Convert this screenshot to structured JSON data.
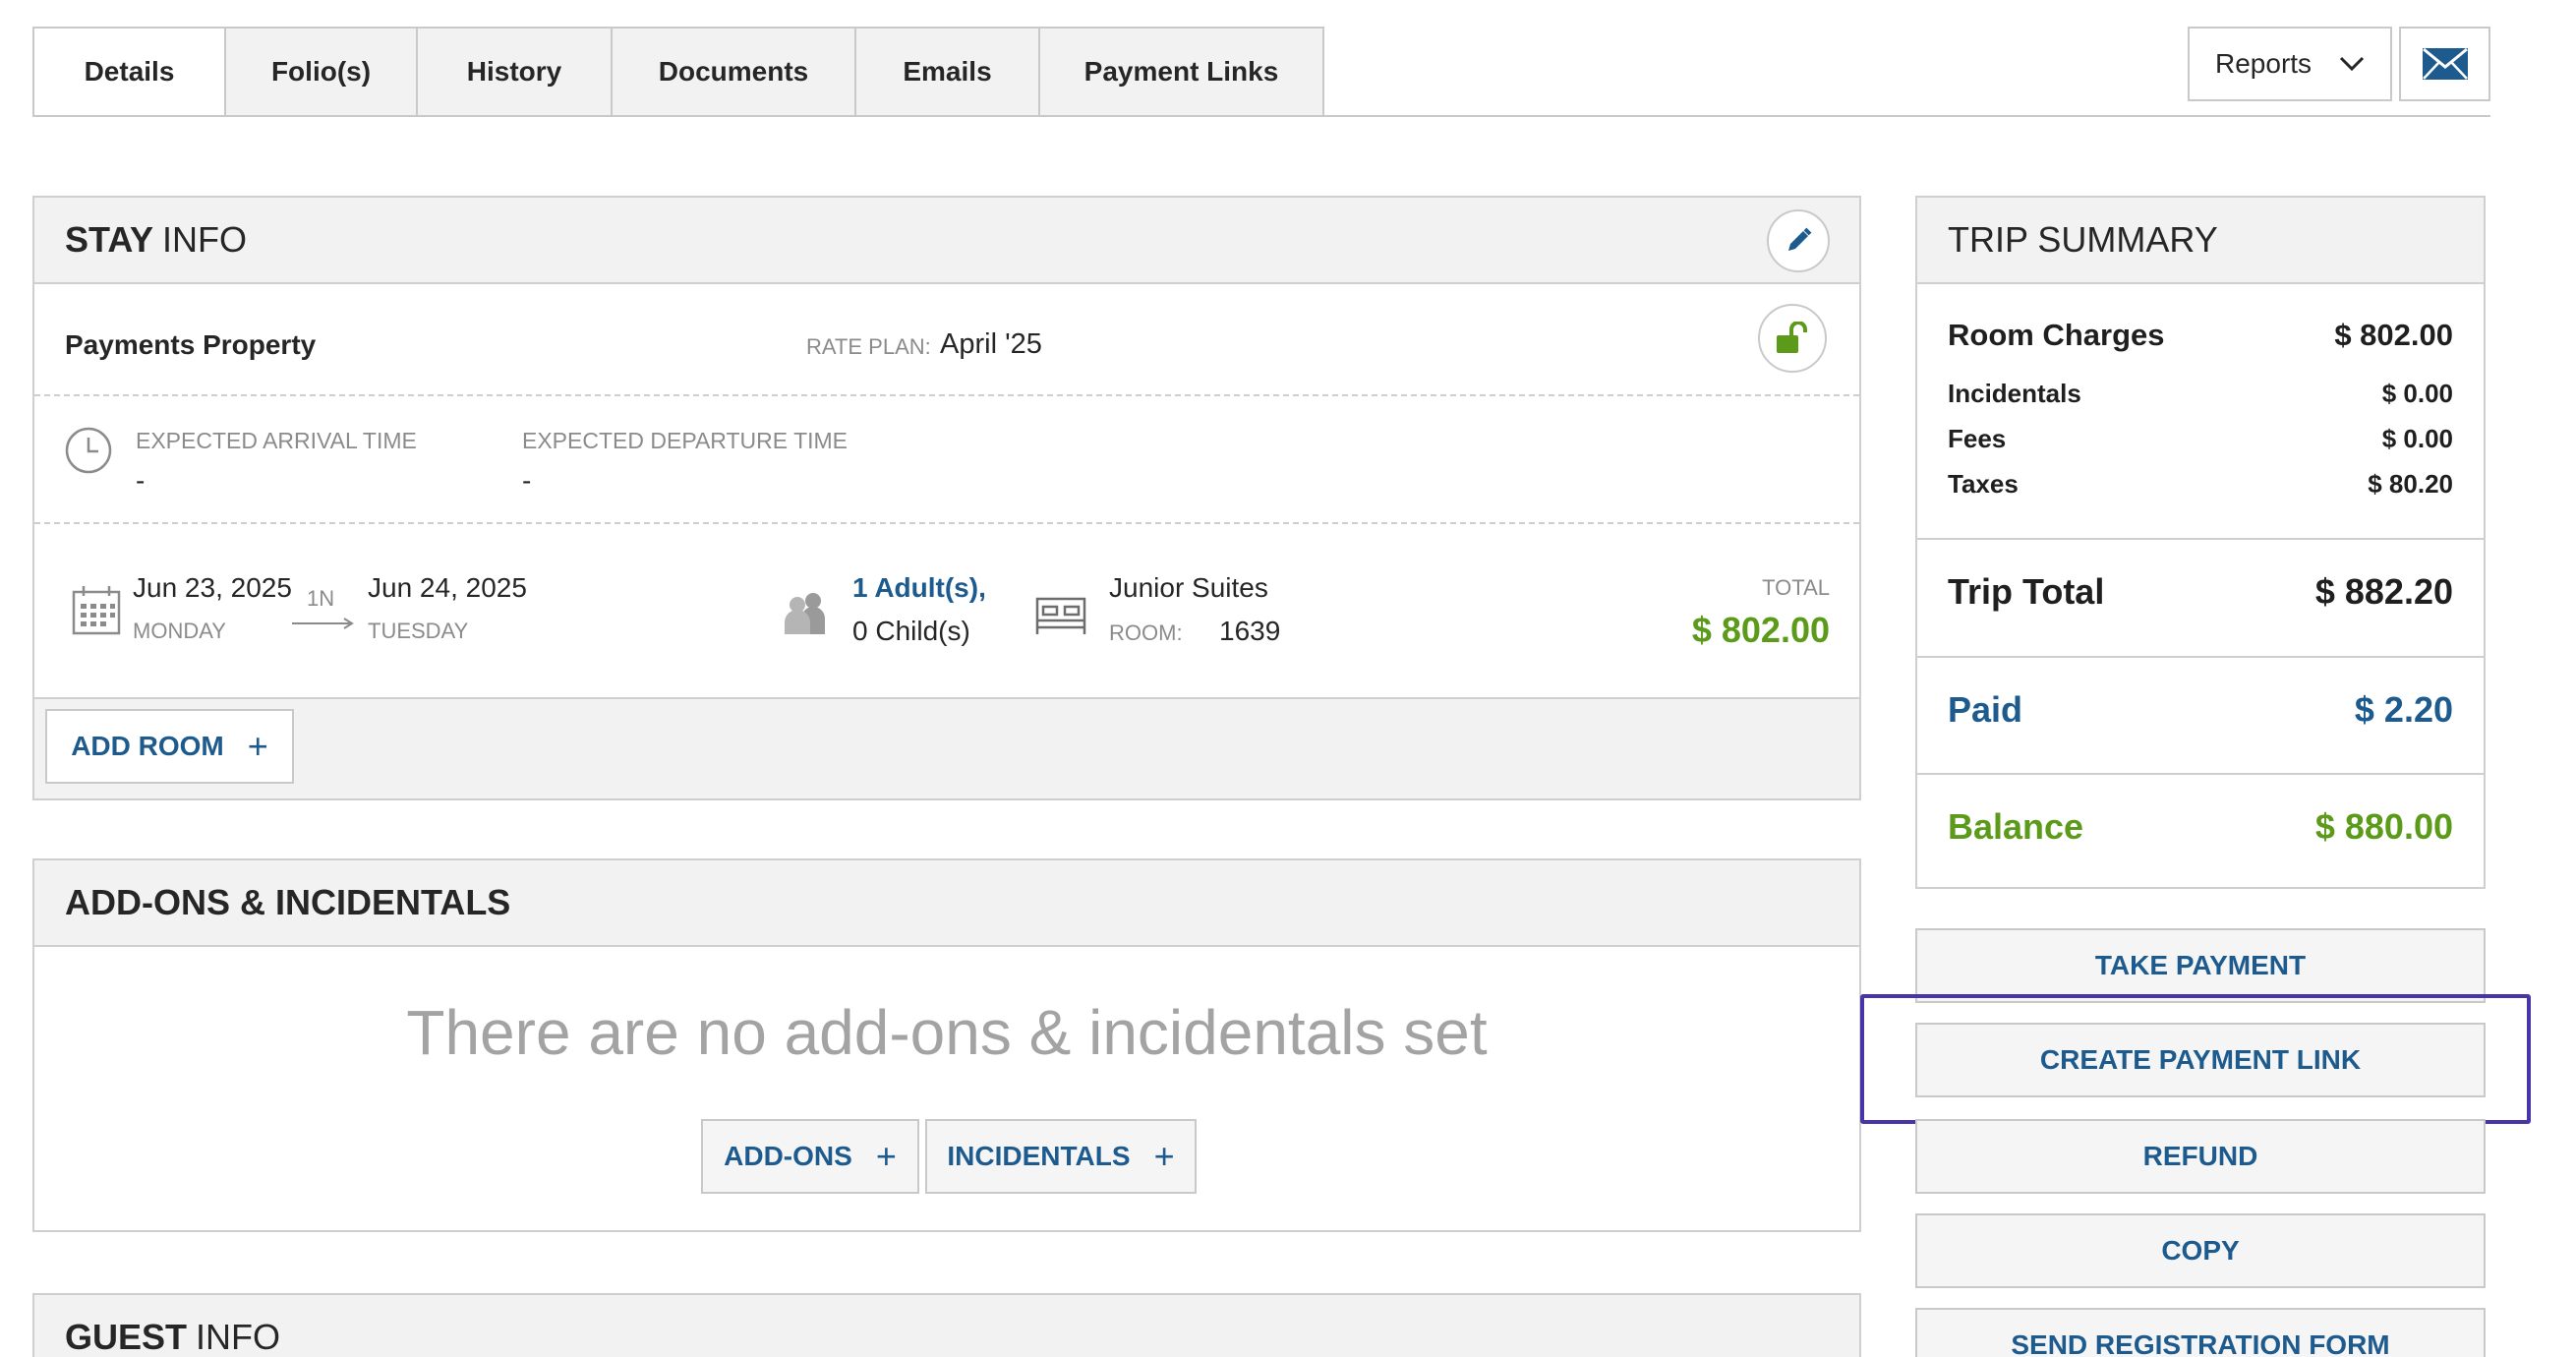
{
  "tabs": [
    {
      "label": "Details",
      "active": true
    },
    {
      "label": "Folio(s)"
    },
    {
      "label": "History"
    },
    {
      "label": "Documents"
    },
    {
      "label": "Emails"
    },
    {
      "label": "Payment Links"
    }
  ],
  "reports_label": "Reports",
  "stay_info": {
    "title_bold": "STAY",
    "title_rest": "INFO",
    "property": "Payments Property",
    "rate_plan_label": "RATE PLAN:",
    "rate_plan": "April '25",
    "arrival_label": "EXPECTED ARRIVAL TIME",
    "arrival_value": "-",
    "departure_label": "EXPECTED DEPARTURE TIME",
    "departure_value": "-",
    "checkin_date": "Jun 23, 2025",
    "checkin_day": "MONDAY",
    "nights": "1N",
    "checkout_date": "Jun 24, 2025",
    "checkout_day": "TUESDAY",
    "adults": "1 Adult(s),",
    "children": "0 Child(s)",
    "room_type": "Junior Suites",
    "room_label": "ROOM:",
    "room_number": "1639",
    "total_label": "TOTAL",
    "total_value": "$ 802.00",
    "add_room": "ADD ROOM"
  },
  "addons": {
    "title": "ADD-ONS & INCIDENTALS",
    "empty_message": "There are no add-ons & incidentals set",
    "addons_button": "ADD-ONS",
    "incidentals_button": "INCIDENTALS"
  },
  "guest_info": {
    "title_bold": "GUEST",
    "title_rest": "INFO"
  },
  "trip_summary": {
    "title": "TRIP SUMMARY",
    "room_charges_label": "Room Charges",
    "room_charges": "$ 802.00",
    "incidentals_label": "Incidentals",
    "incidentals": "$ 0.00",
    "fees_label": "Fees",
    "fees": "$ 0.00",
    "taxes_label": "Taxes",
    "taxes": "$ 80.20",
    "trip_total_label": "Trip Total",
    "trip_total": "$ 882.20",
    "paid_label": "Paid",
    "paid": "$ 2.20",
    "balance_label": "Balance",
    "balance": "$ 880.00"
  },
  "actions": {
    "take_payment": "TAKE PAYMENT",
    "create_payment_link": "CREATE PAYMENT LINK",
    "refund": "REFUND",
    "copy": "COPY",
    "send_registration_form": "SEND REGISTRATION FORM"
  },
  "colors": {
    "accent_blue": "#1d5a8e",
    "money_green": "#5c9a1a",
    "highlight_purple": "#4a35a8"
  }
}
